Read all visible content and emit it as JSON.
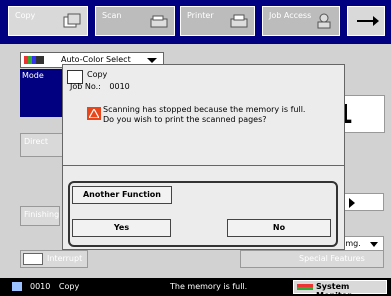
{
  "tabs": [
    {
      "label": "Copy"
    },
    {
      "label": "Scan"
    },
    {
      "label": "Printer"
    },
    {
      "label": "Job Access"
    }
  ],
  "background": {
    "color_select": "Auto-Color Select",
    "mode_label": "Mode",
    "direct_label": "Direct",
    "finishing_label": "Finishing",
    "copy_count": "1",
    "img_label": "Img.",
    "interrupt_label": "Interrupt",
    "special_features_label": "Special Features"
  },
  "dialog": {
    "function_label": "Copy",
    "job_no_label": "Job No.:",
    "job_no_value": "0010",
    "message_line1": "Scanning has stopped because the memory is full.",
    "message_line2": "Do you wish to print the scanned pages?",
    "another_function_label": "Another Function",
    "yes_label": "Yes",
    "no_label": "No"
  },
  "status": {
    "job": "0010",
    "function": "Copy",
    "message": "The memory is full.",
    "system_monitor_label": "System Monitor"
  },
  "colors": {
    "brand_blue": "#000080",
    "warn_orange": "#e8451a"
  }
}
